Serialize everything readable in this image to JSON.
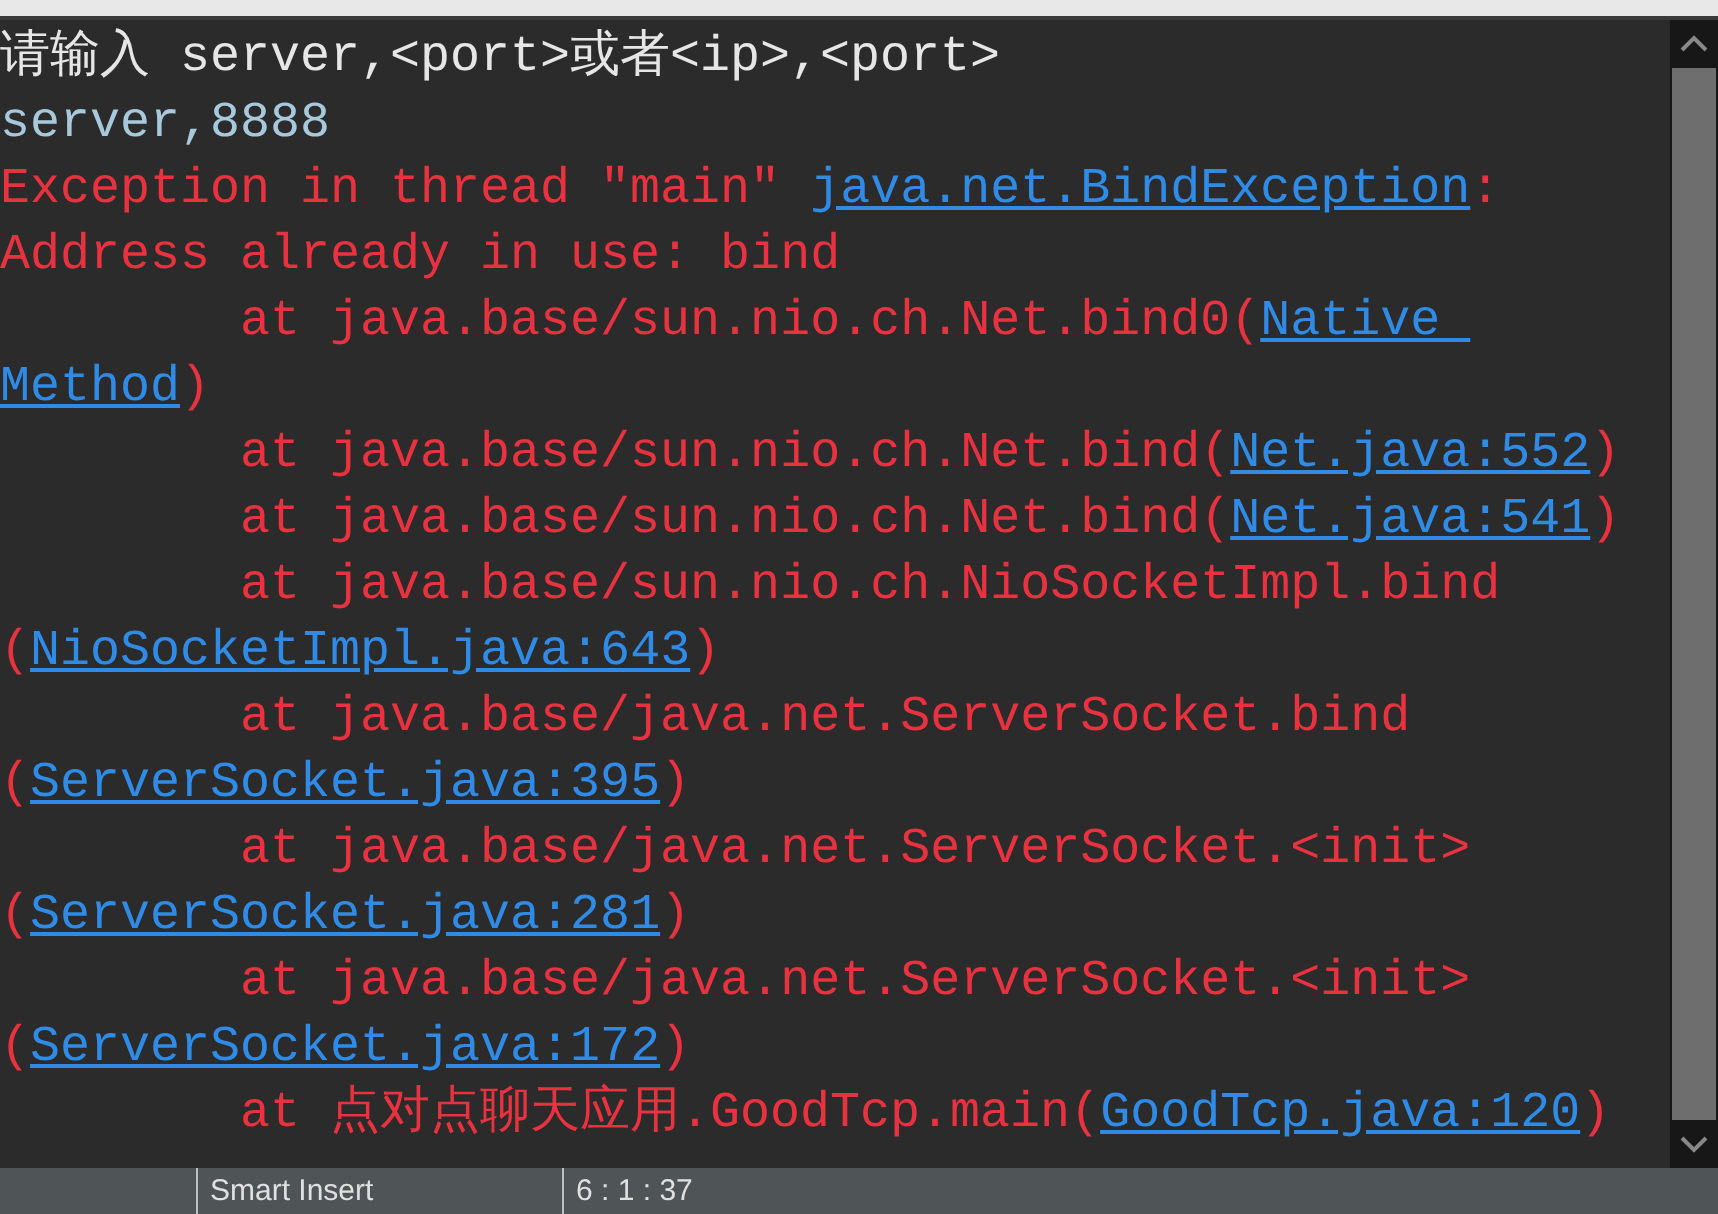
{
  "console": {
    "lines": [
      {
        "kind": "stdout",
        "segments": [
          {
            "kind": "text",
            "text": "请输入 server,<port>或者<ip>,<port>"
          }
        ]
      },
      {
        "kind": "stdin",
        "segments": [
          {
            "kind": "text",
            "text": "server,8888"
          }
        ]
      },
      {
        "kind": "stderr",
        "segments": [
          {
            "kind": "text",
            "text": "Exception in thread \"main\" "
          },
          {
            "kind": "link",
            "text": "java.net.BindException"
          },
          {
            "kind": "text",
            "text": ":"
          }
        ]
      },
      {
        "kind": "stderr",
        "segments": [
          {
            "kind": "text",
            "text": "Address already in use: bind"
          }
        ]
      },
      {
        "kind": "stderr",
        "segments": [
          {
            "kind": "text",
            "text": "        at java.base/sun.nio.ch.Net.bind0("
          },
          {
            "kind": "link",
            "text": "Native "
          }
        ]
      },
      {
        "kind": "stderr",
        "segments": [
          {
            "kind": "link",
            "text": "Method"
          },
          {
            "kind": "text",
            "text": ")"
          }
        ]
      },
      {
        "kind": "stderr",
        "segments": [
          {
            "kind": "text",
            "text": "        at java.base/sun.nio.ch.Net.bind("
          },
          {
            "kind": "link",
            "text": "Net.java:552"
          },
          {
            "kind": "text",
            "text": ")"
          }
        ]
      },
      {
        "kind": "stderr",
        "segments": [
          {
            "kind": "text",
            "text": "        at java.base/sun.nio.ch.Net.bind("
          },
          {
            "kind": "link",
            "text": "Net.java:541"
          },
          {
            "kind": "text",
            "text": ")"
          }
        ]
      },
      {
        "kind": "stderr",
        "segments": [
          {
            "kind": "text",
            "text": "        at java.base/sun.nio.ch.NioSocketImpl.bind"
          }
        ]
      },
      {
        "kind": "stderr",
        "segments": [
          {
            "kind": "text",
            "text": "("
          },
          {
            "kind": "link",
            "text": "NioSocketImpl.java:643"
          },
          {
            "kind": "text",
            "text": ")"
          }
        ]
      },
      {
        "kind": "stderr",
        "segments": [
          {
            "kind": "text",
            "text": "        at java.base/java.net.ServerSocket.bind"
          }
        ]
      },
      {
        "kind": "stderr",
        "segments": [
          {
            "kind": "text",
            "text": "("
          },
          {
            "kind": "link",
            "text": "ServerSocket.java:395"
          },
          {
            "kind": "text",
            "text": ")"
          }
        ]
      },
      {
        "kind": "stderr",
        "segments": [
          {
            "kind": "text",
            "text": "        at java.base/java.net.ServerSocket.<init>"
          }
        ]
      },
      {
        "kind": "stderr",
        "segments": [
          {
            "kind": "text",
            "text": "("
          },
          {
            "kind": "link",
            "text": "ServerSocket.java:281"
          },
          {
            "kind": "text",
            "text": ")"
          }
        ]
      },
      {
        "kind": "stderr",
        "segments": [
          {
            "kind": "text",
            "text": "        at java.base/java.net.ServerSocket.<init>"
          }
        ]
      },
      {
        "kind": "stderr",
        "segments": [
          {
            "kind": "text",
            "text": "("
          },
          {
            "kind": "link",
            "text": "ServerSocket.java:172"
          },
          {
            "kind": "text",
            "text": ")"
          }
        ]
      },
      {
        "kind": "stderr",
        "segments": [
          {
            "kind": "text",
            "text": "        at 点对点聊天应用.GoodTcp.main("
          },
          {
            "kind": "link",
            "text": "GoodTcp.java:120"
          },
          {
            "kind": "text",
            "text": ")"
          }
        ]
      }
    ]
  },
  "status_bar": {
    "insert_mode": "Smart Insert",
    "position": "6 : 1 : 37"
  }
}
